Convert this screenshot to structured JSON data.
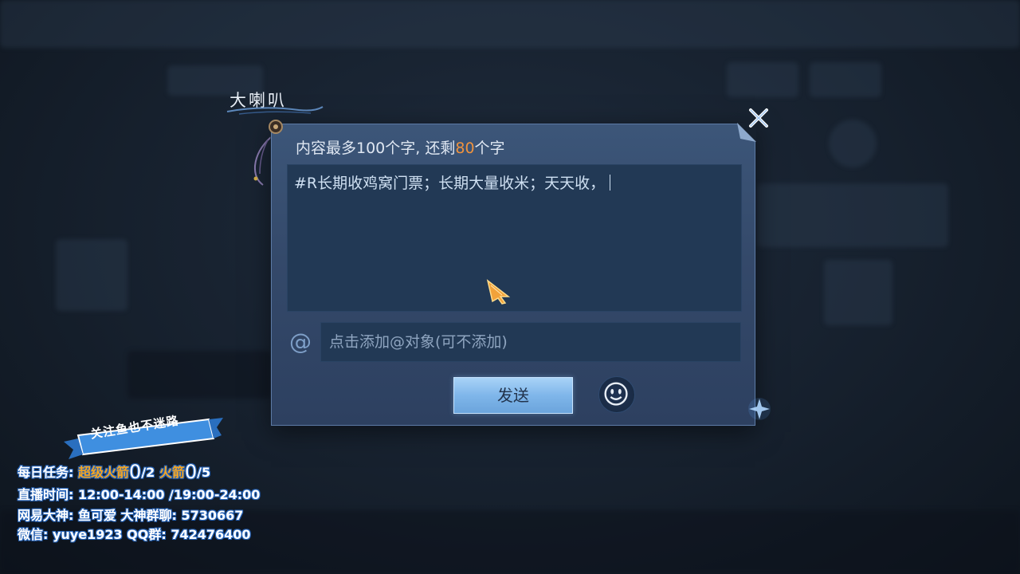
{
  "title": "大喇叭",
  "dialog": {
    "limit_prefix": "内容最多100个字, 还剩",
    "limit_remaining": "80",
    "limit_suffix": "个字",
    "message_text": "#R长期收鸡窝门票；长期大量收米；天天收，",
    "at_placeholder": "点击添加@对象(可不添加)",
    "at_symbol": "@",
    "send_label": "发送",
    "emoji_icon": "smiley-face-icon",
    "close_icon": "close-icon"
  },
  "overlay": {
    "banner": "关注鱼也不迷路",
    "task_prefix": "每日任务:",
    "task_item1": "超级火箭",
    "task_count1": "0",
    "task_total1": "/2",
    "task_item2": "火箭",
    "task_count2": "0",
    "task_total2": "/5",
    "live_time": "直播时间: 12:00-14:00 /19:00-24:00",
    "dashen": "网易大神: 鱼可爱   大神群聊: 5730667",
    "wechat": "微信: yuye1923   QQ群: 742476400"
  },
  "colors": {
    "accent_orange": "#f0933e",
    "dialog_bg": "#34496a",
    "input_bg": "#223955",
    "send_button": "#7fb6ea"
  }
}
